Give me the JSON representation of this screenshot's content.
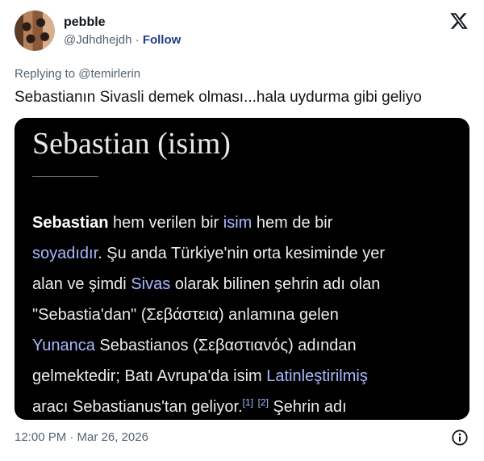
{
  "author": {
    "display_name": "pebble",
    "handle": "@Jdhdhejdh",
    "separator": "·",
    "follow_label": "Follow"
  },
  "reply_context": {
    "prefix": "Replying to",
    "handle": "@temirlerin"
  },
  "tweet": {
    "text": "Sebastianın Sivasli demek olması...hala uydurma gibi geliyo"
  },
  "media": {
    "title": "Sebastian (isim)",
    "lines": [
      [
        {
          "t": "Sebastian",
          "s": "bold"
        },
        {
          "t": " hem verilen bir ",
          "s": "text"
        },
        {
          "t": "isim",
          "s": "link"
        },
        {
          "t": " hem de bir",
          "s": "text"
        }
      ],
      [
        {
          "t": "soyadıdır",
          "s": "link"
        },
        {
          "t": ". Şu anda Türkiye'nin orta kesiminde yer",
          "s": "text"
        }
      ],
      [
        {
          "t": "alan ve şimdi ",
          "s": "text"
        },
        {
          "t": "Sivas",
          "s": "link"
        },
        {
          "t": " olarak bilinen şehrin adı olan",
          "s": "text"
        }
      ],
      [
        {
          "t": "\"Sebastia'dan\" (Σεβάστεια) anlamına gelen",
          "s": "text"
        }
      ],
      [
        {
          "t": "Yunanca",
          "s": "link"
        },
        {
          "t": " Sebastianos (Σεβαστιανός) adından",
          "s": "text"
        }
      ],
      [
        {
          "t": "gelmektedir; Batı Avrupa'da isim ",
          "s": "text"
        },
        {
          "t": "Latinleştirilmiş",
          "s": "link"
        }
      ],
      [
        {
          "t": "aracı Sebastianus'tan geliyor.",
          "s": "text"
        },
        {
          "t": "[1]",
          "s": "sup"
        },
        {
          "t": " ",
          "s": "text"
        },
        {
          "t": "[2]",
          "s": "sup"
        },
        {
          "t": " Şehrin adı",
          "s": "text"
        }
      ]
    ]
  },
  "footer": {
    "timestamp": "12:00 PM · Mar 26, 2026"
  },
  "icons": {
    "x_logo": "x-logo-icon",
    "info": "info-icon"
  },
  "colors": {
    "follow": "#1d3f8a",
    "muted": "#536471",
    "wiki_link": "#a9b8ff",
    "card_bg": "#000000"
  }
}
